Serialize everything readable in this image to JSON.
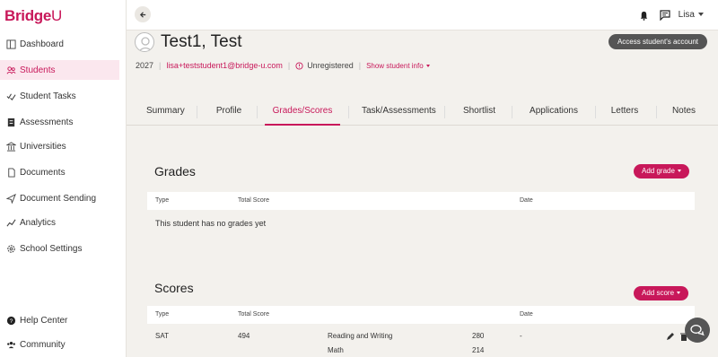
{
  "app": {
    "logo_text": "Bridge",
    "logo_u": "U"
  },
  "sidebar": {
    "items": [
      {
        "label": "Dashboard",
        "icon": "dashboard-icon"
      },
      {
        "label": "Students",
        "icon": "students-icon",
        "active": true
      },
      {
        "label": "Student Tasks",
        "icon": "tasks-check-icon"
      },
      {
        "label": "Assessments",
        "icon": "assessment-icon"
      },
      {
        "label": "Universities",
        "icon": "university-icon"
      },
      {
        "label": "Documents",
        "icon": "document-icon"
      },
      {
        "label": "Document Sending",
        "icon": "send-icon"
      },
      {
        "label": "Analytics",
        "icon": "analytics-icon"
      },
      {
        "label": "School Settings",
        "icon": "gear-icon"
      }
    ],
    "bottom": [
      {
        "label": "Help Center",
        "icon": "help-icon"
      },
      {
        "label": "Community",
        "icon": "community-icon"
      }
    ]
  },
  "topbar": {
    "user_name": "Lisa"
  },
  "student": {
    "name": "Test1, Test",
    "year": "2027",
    "email": "lisa+teststudent1@bridge-u.com",
    "status": "Unregistered",
    "show_info": "Show student info",
    "access_button": "Access student's account"
  },
  "tabs": [
    {
      "label": "Summary"
    },
    {
      "label": "Profile"
    },
    {
      "label": "Grades/Scores",
      "active": true
    },
    {
      "label": "Task/Assessments"
    },
    {
      "label": "Shortlist"
    },
    {
      "label": "Applications"
    },
    {
      "label": "Letters"
    },
    {
      "label": "Notes"
    }
  ],
  "grades": {
    "title": "Grades",
    "add_button": "Add grade",
    "columns": [
      "Type",
      "Total Score",
      "Date"
    ],
    "empty_message": "This student has no grades yet"
  },
  "scores": {
    "title": "Scores",
    "add_button": "Add score",
    "columns": [
      "Type",
      "Total Score",
      "Date"
    ],
    "rows": [
      {
        "type": "SAT",
        "total": "494",
        "date": "-",
        "subscores": [
          {
            "name": "Reading and Writing",
            "value": "280"
          },
          {
            "name": "Math",
            "value": "214"
          }
        ]
      }
    ]
  },
  "colors": {
    "accent": "#c8185a",
    "background": "#f3f1ed",
    "dark_button": "#555555"
  }
}
